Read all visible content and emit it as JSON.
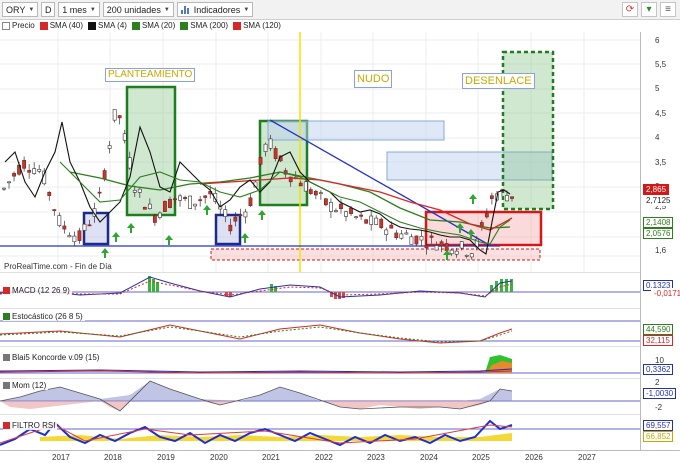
{
  "toolbar": {
    "symbol": "ORY",
    "chart_type_label": "D",
    "period": "1 mes",
    "units": "200 unidades",
    "indicators": "Indicadores"
  },
  "legend": {
    "items": [
      {
        "label": "Precio",
        "color": "#ffffff"
      },
      {
        "label": "SMA (40)",
        "color": "#d62828"
      },
      {
        "label": "SMA (4)",
        "color": "#111111"
      },
      {
        "label": "SMA (20)",
        "color": "#2e7d1e"
      },
      {
        "label": "SMA (200)",
        "color": "#2e7d1e"
      },
      {
        "label": "SMA (120)",
        "color": "#d62828"
      }
    ]
  },
  "annotations": {
    "planteamiento": "PLANTEAMIENTO",
    "nudo": "NUDO",
    "desenlace": "DESENLACE"
  },
  "source_label": "ProRealTime.com - Fin de Día",
  "price_scale": {
    "ticks": [
      "6",
      "5,5",
      "5",
      "4,5",
      "4",
      "3,5",
      "3",
      "2,5",
      "2",
      "1,6"
    ],
    "last_price": "2,865",
    "boxes": [
      "2,7125",
      "2,1408",
      "2,0576"
    ]
  },
  "panels": {
    "macd": {
      "title": "MACD (12 26 9)",
      "values": [
        "0,1323",
        "-0,0171"
      ],
      "tick": "0"
    },
    "stoch": {
      "title": "Estocástico (26 8 5)",
      "values": [
        "44,590",
        "32,115"
      ]
    },
    "blai5": {
      "title": "Blai5 Koncorde v.09 (15)",
      "values": [
        "10",
        "0,3362"
      ],
      "tick": "0"
    },
    "mom": {
      "title": "Mom (12)",
      "values": [
        "2",
        "-1,0030",
        "-2"
      ]
    },
    "rsi": {
      "title": "FILTRO RSI",
      "values": [
        "69,557",
        "66,852"
      ]
    }
  },
  "xaxis": {
    "labels": [
      "2017",
      "2018",
      "2019",
      "2020",
      "2021",
      "2022",
      "2023",
      "2024",
      "2025",
      "2026",
      "2027"
    ]
  },
  "chart_data": {
    "type": "line",
    "title": "",
    "series": [
      {
        "name": "Precio",
        "x": [
          "2016-09",
          "2017-01",
          "2017-05",
          "2017-09",
          "2018-01",
          "2018-05",
          "2018-09",
          "2019-01",
          "2019-05",
          "2019-09",
          "2020-01",
          "2020-05",
          "2020-09",
          "2021-01",
          "2021-05",
          "2021-09",
          "2022-01",
          "2022-05",
          "2022-09",
          "2023-01",
          "2023-05",
          "2023-09",
          "2024-01",
          "2024-05",
          "2024-09",
          "2025-01",
          "2025-05",
          "2025-07"
        ],
        "values": [
          3.0,
          3.6,
          3.4,
          2.2,
          1.9,
          2.6,
          4.9,
          3.0,
          2.4,
          2.8,
          2.7,
          2.9,
          2.2,
          2.6,
          4.1,
          3.4,
          3.1,
          2.7,
          2.5,
          2.3,
          2.2,
          2.0,
          1.9,
          1.8,
          1.7,
          1.6,
          2.9,
          2.865
        ]
      }
    ],
    "ylim": [
      1.5,
      6.1
    ],
    "xlabel": "",
    "ylabel": ""
  }
}
